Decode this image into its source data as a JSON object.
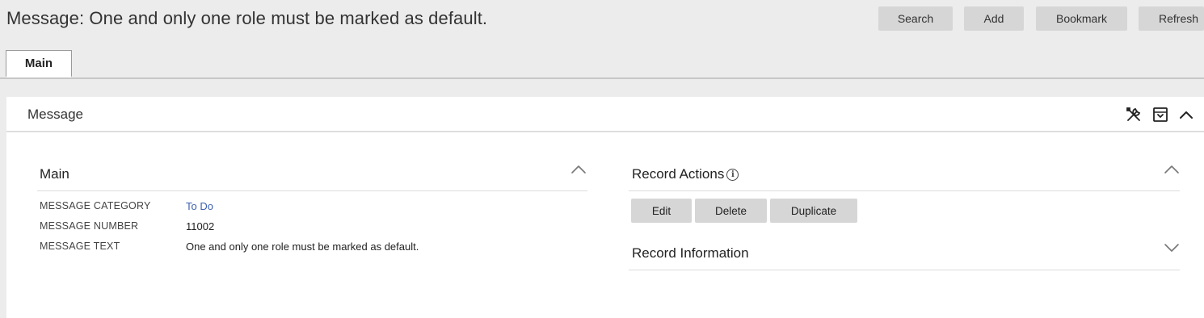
{
  "header": {
    "title": "Message: One and only one role must be marked as default.",
    "buttons": {
      "search": "Search",
      "add": "Add",
      "bookmark": "Bookmark",
      "refresh": "Refresh"
    }
  },
  "tabs": [
    {
      "label": "Main",
      "selected": true
    }
  ],
  "panel": {
    "title": "Message",
    "icons": [
      "tools-icon",
      "save-to-box-icon",
      "chevron-up-icon"
    ]
  },
  "main_section": {
    "title": "Main",
    "fields": [
      {
        "label": "MESSAGE CATEGORY",
        "value": "To Do",
        "link": true
      },
      {
        "label": "MESSAGE NUMBER",
        "value": "11002",
        "link": false
      },
      {
        "label": "MESSAGE TEXT",
        "value": "One and only one role must be marked as default.",
        "link": false
      }
    ]
  },
  "record_actions": {
    "title": "Record Actions",
    "buttons": {
      "edit": "Edit",
      "delete": "Delete",
      "duplicate": "Duplicate"
    }
  },
  "record_information": {
    "title": "Record Information"
  },
  "colors": {
    "background": "#ececec",
    "button": "#d6d6d6",
    "link": "#3d5fb0",
    "panel": "#ffffff"
  }
}
